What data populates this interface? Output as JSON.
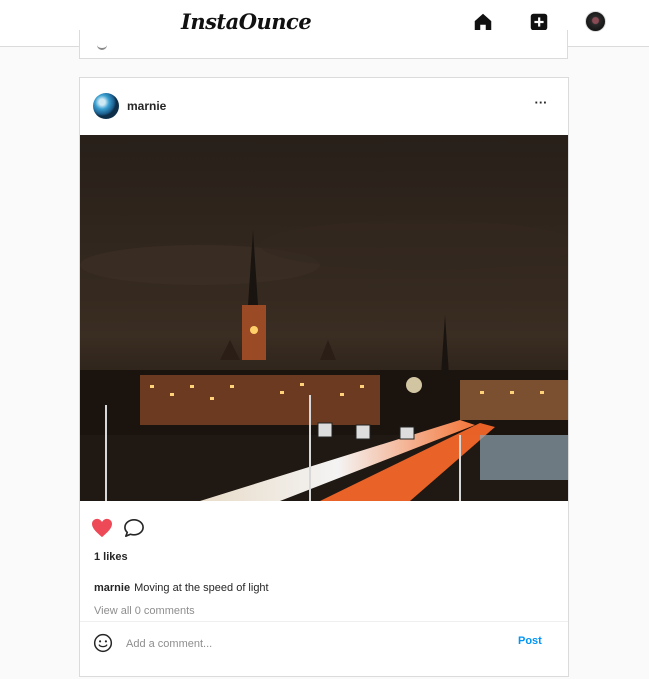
{
  "app": {
    "logo": "InstaOunce"
  },
  "nav": {
    "home_icon": "home-icon",
    "new_post_icon": "plus-square-icon",
    "avatar_icon": "user-avatar"
  },
  "post": {
    "username": "marnie",
    "more_icon": "···",
    "image_description_icon": "photo",
    "like_icon": "heart-icon",
    "like_color": "#ed4956",
    "comment_icon": "speech-bubble-icon",
    "likes_text": "1 likes",
    "caption_user": "marnie",
    "caption_text": "Moving at the speed of light",
    "view_comments": "View all 0 comments",
    "comment_placeholder": "Add a comment...",
    "post_button": "Post",
    "accent_color": "#0095f6"
  }
}
